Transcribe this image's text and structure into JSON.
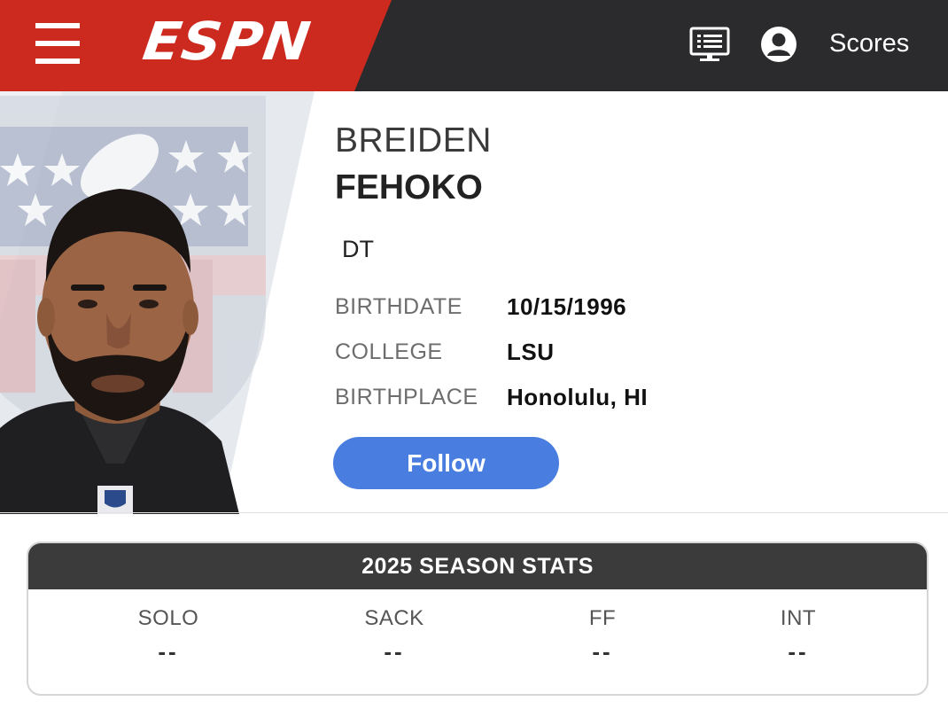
{
  "header": {
    "logo_text": "ESPN",
    "scores_label": "Scores",
    "icons": [
      "menu-icon",
      "scoreboard-icon",
      "account-icon"
    ],
    "colors": {
      "brand_red": "#cc2a1f",
      "bar": "#2b2b2d"
    }
  },
  "player": {
    "first_name": "BREIDEN",
    "last_name": "FEHOKO",
    "position": "DT",
    "bio": [
      {
        "label": "BIRTHDATE",
        "value": "10/15/1996"
      },
      {
        "label": "COLLEGE",
        "value": "LSU"
      },
      {
        "label": "BIRTHPLACE",
        "value": "Honolulu, HI"
      }
    ],
    "follow_label": "Follow",
    "follow_color": "#4a7de0"
  },
  "stats": {
    "title": "2025 SEASON STATS",
    "columns": [
      {
        "label": "SOLO",
        "value": "--"
      },
      {
        "label": "SACK",
        "value": "--"
      },
      {
        "label": "FF",
        "value": "--"
      },
      {
        "label": "INT",
        "value": "--"
      }
    ]
  }
}
